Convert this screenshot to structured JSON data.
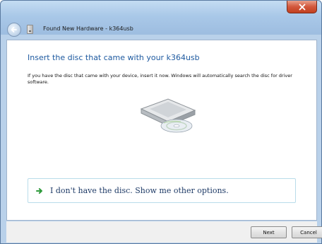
{
  "window": {
    "title": "Found New Hardware - k364usb"
  },
  "content": {
    "heading": "Insert the disc that came with your k364usb",
    "description": "If you have the disc that came with your device, insert it now.  Windows will automatically search the disc for driver software.",
    "option_label": "I don't have the disc.  Show me other options."
  },
  "footer": {
    "next_label": "Next",
    "cancel_label": "Cancel"
  },
  "icons": {
    "back": "back-arrow-icon",
    "hardware": "hardware-device-icon",
    "close": "close-icon",
    "disc_drive": "disc-drive-icon",
    "option_arrow": "green-arrow-icon"
  },
  "colors": {
    "heading": "#1e5aa0",
    "option_border": "#b9dcea",
    "arrow_green": "#2e9a3a",
    "close_red": "#c2401f"
  }
}
